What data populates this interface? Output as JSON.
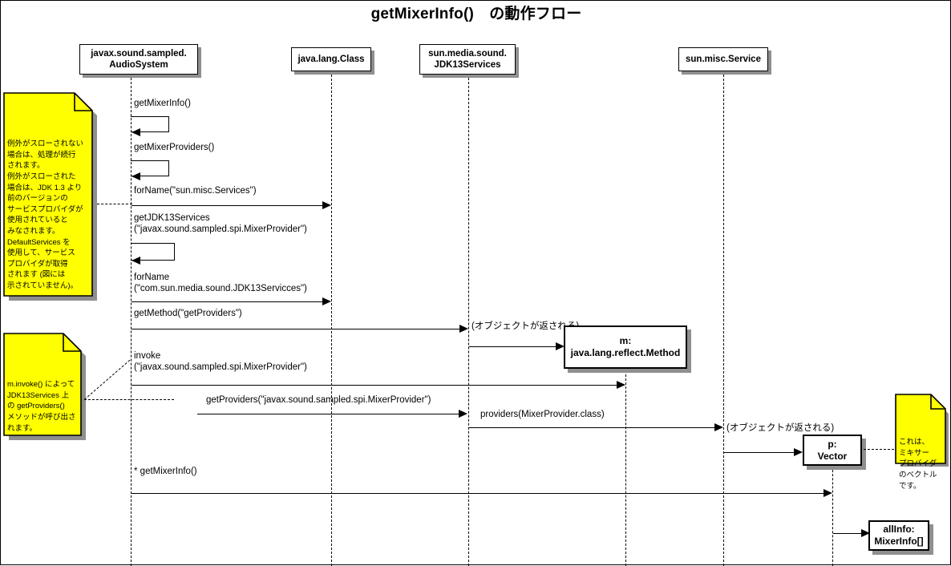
{
  "title": "getMixerInfo()　の動作フロー",
  "colors": {
    "note_fill": "#ffff00",
    "note_border": "#000000",
    "shadow": "#8f8f8f",
    "line": "#000000",
    "background": "#ffffff"
  },
  "lifelines": [
    {
      "id": "audiosystem",
      "label": "javax.sound.sampled.\nAudioSystem"
    },
    {
      "id": "javalangclass",
      "label": "java.lang.Class"
    },
    {
      "id": "jdk13services",
      "label": "sun.media.sound.\nJDK13Services"
    },
    {
      "id": "sunmiscservice",
      "label": "sun.misc.Service"
    }
  ],
  "objects": [
    {
      "id": "method-object",
      "label": "m:\njava.lang.reflect.Method"
    },
    {
      "id": "vector-object",
      "label": "p:\nVector"
    },
    {
      "id": "allinfo-object",
      "label": "allInfo:\nMixerInfo[]"
    }
  ],
  "messages": [
    {
      "id": "msg-getmixerinfo",
      "label": "getMixerInfo()",
      "kind": "self-call"
    },
    {
      "id": "msg-getmixerproviders",
      "label": "getMixerProviders()",
      "kind": "self-call"
    },
    {
      "id": "msg-forname-services",
      "label": "forName(\"sun.misc.Services\")",
      "kind": "call"
    },
    {
      "id": "msg-getjdk13services",
      "label": "getJDK13Services\n(\"javax.sound.sampled.spi.MixerProvider\")",
      "kind": "self-call"
    },
    {
      "id": "msg-forname-jdk13",
      "label": "forName\n(\"com.sun.media.sound.JDK13Servicces\")",
      "kind": "call"
    },
    {
      "id": "msg-getmethod",
      "label": "getMethod(\"getProviders\")",
      "kind": "call"
    },
    {
      "id": "msg-return-object-1",
      "label": "(オブジェクトが返される)",
      "kind": "return"
    },
    {
      "id": "msg-invoke",
      "label": "invoke\n(\"javax.sound.sampled.spi.MixerProvider\")",
      "kind": "call"
    },
    {
      "id": "msg-getproviders",
      "label": "getProviders(\"javax.sound.sampled.spi.MixerProvider\")",
      "kind": "call"
    },
    {
      "id": "msg-providers",
      "label": "providers(MixerProvider.class)",
      "kind": "call"
    },
    {
      "id": "msg-return-object-2",
      "label": "(オブジェクトが返される)",
      "kind": "return"
    },
    {
      "id": "msg-star-getmixerinfo",
      "label": "* getMixerInfo()",
      "kind": "call"
    }
  ],
  "notes": [
    {
      "id": "note-exception",
      "text": "例外がスローされない\n場合は、処理が続行\nされます。\n例外がスローされた\n場合は、JDK 1.3 より\n前のバージョンの\nサービスプロバイダが\n使用されていると\nみなされます。\nDefaultServices を\n使用して、サービス\nプロバイダが取得\nされます (図には\n示されていません)。"
    },
    {
      "id": "note-invoke",
      "text": "m.invoke() によって\nJDK13Services 上\nの getProviders()\nメソッドが呼び出さ\nれます。"
    },
    {
      "id": "note-vector",
      "text": "これは、\nミキサー\nプロバイダ\nのベクトル\nです。"
    }
  ]
}
